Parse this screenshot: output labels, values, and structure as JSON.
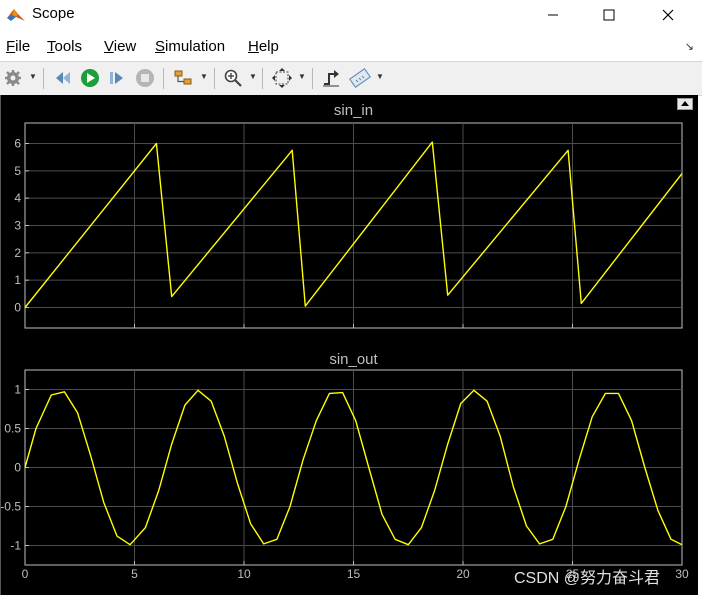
{
  "window": {
    "title": "Scope",
    "minimize_icon": "minimize-icon",
    "maximize_icon": "maximize-icon",
    "close_icon": "close-icon"
  },
  "menu": [
    {
      "label": "File",
      "mnemonic": "F",
      "rest": "ile"
    },
    {
      "label": "Tools",
      "mnemonic": "T",
      "rest": "ools"
    },
    {
      "label": "View",
      "mnemonic": "V",
      "rest": "iew"
    },
    {
      "label": "Simulation",
      "mnemonic": "S",
      "rest": "imulation"
    },
    {
      "label": "Help",
      "mnemonic": "H",
      "rest": "elp"
    }
  ],
  "toolbar": [
    "gear-icon",
    "step-back-icon",
    "run-icon",
    "step-forward-icon",
    "stop-icon",
    "highlight-icon",
    "zoom-in-icon",
    "fit-axes-icon",
    "triggers-icon",
    "measurements-icon"
  ],
  "colors": {
    "plot_bg": "#000000",
    "line": "#ffff00",
    "grid": "#4d4d4d",
    "axes": "#bfbfbf",
    "title": "#bfbfbf"
  },
  "watermark": "CSDN @努力奋斗君",
  "chart_data": [
    {
      "type": "line",
      "title": "sin_in",
      "xlim": [
        0,
        30
      ],
      "ylim": [
        -0.75,
        6.75
      ],
      "yticks": [
        0,
        1,
        2,
        3,
        4,
        5,
        6
      ],
      "ytick_labels": [
        "0",
        "1",
        "2",
        "3",
        "4",
        "5",
        "6"
      ],
      "xticks": [
        0,
        5,
        10,
        15,
        20,
        25,
        30
      ],
      "xtick_labels": [],
      "grid": true,
      "series": [
        {
          "values_x": [
            0,
            6.0,
            6.7,
            12.2,
            12.8,
            18.6,
            19.3,
            24.8,
            25.4,
            30
          ],
          "values_y": [
            0,
            6.0,
            0.4,
            5.75,
            0.05,
            6.05,
            0.45,
            5.75,
            0.15,
            4.9
          ]
        }
      ]
    },
    {
      "type": "line",
      "title": "sin_out",
      "xlim": [
        0,
        30
      ],
      "ylim": [
        -1.25,
        1.25
      ],
      "yticks": [
        1,
        0.5,
        0,
        -0.5,
        -1
      ],
      "ytick_labels": [
        "1",
        "0.5",
        "0",
        "-0.5",
        "-1"
      ],
      "xticks": [
        0,
        5,
        10,
        15,
        20,
        25,
        30
      ],
      "xtick_labels": [
        "0",
        "5",
        "10",
        "15",
        "20",
        "25",
        "30"
      ],
      "grid": true,
      "series": [
        {
          "values_x": [
            0,
            0.5,
            1.2,
            1.8,
            2.4,
            3.0,
            3.6,
            4.2,
            4.8,
            5.5,
            6.1,
            6.7,
            7.3,
            7.9,
            8.5,
            9.1,
            9.7,
            10.3,
            10.9,
            11.5,
            12.1,
            12.7,
            13.3,
            13.9,
            14.5,
            15.1,
            15.7,
            16.3,
            16.9,
            17.5,
            18.1,
            18.7,
            19.3,
            19.9,
            20.5,
            21.1,
            21.7,
            22.3,
            22.9,
            23.5,
            24.1,
            24.7,
            25.3,
            25.9,
            26.5,
            27.1,
            27.7,
            28.3,
            28.9,
            29.5,
            30
          ],
          "values_y": [
            0,
            0.5,
            0.93,
            0.97,
            0.7,
            0.15,
            -0.45,
            -0.88,
            -0.99,
            -0.77,
            -0.3,
            0.3,
            0.8,
            0.99,
            0.85,
            0.4,
            -0.2,
            -0.72,
            -0.98,
            -0.92,
            -0.5,
            0.1,
            0.6,
            0.95,
            0.96,
            0.6,
            0.0,
            -0.6,
            -0.92,
            -0.99,
            -0.77,
            -0.3,
            0.3,
            0.82,
            0.99,
            0.85,
            0.4,
            -0.25,
            -0.75,
            -0.98,
            -0.92,
            -0.5,
            0.1,
            0.65,
            0.95,
            0.95,
            0.6,
            0.0,
            -0.55,
            -0.92,
            -0.99
          ]
        }
      ]
    }
  ]
}
